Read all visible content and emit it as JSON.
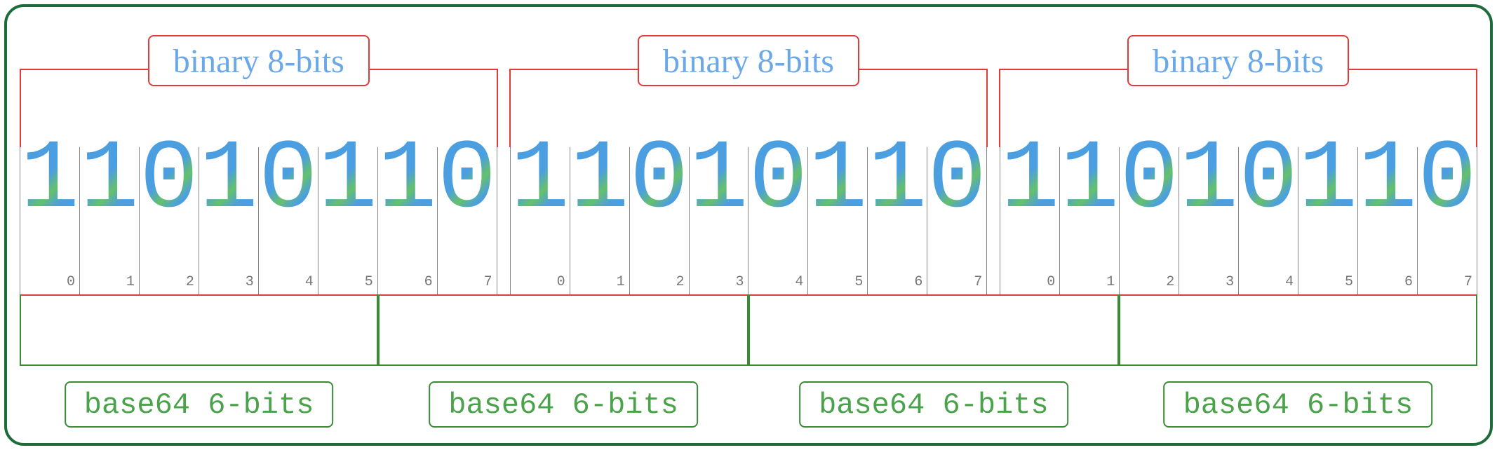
{
  "binary_label": "binary 8-bits",
  "base64_label": "base64 6-bits",
  "bytes": [
    {
      "bits": [
        "1",
        "1",
        "0",
        "1",
        "0",
        "1",
        "1",
        "0"
      ],
      "idx": [
        "0",
        "1",
        "2",
        "3",
        "4",
        "5",
        "6",
        "7"
      ]
    },
    {
      "bits": [
        "1",
        "1",
        "0",
        "1",
        "0",
        "1",
        "1",
        "0"
      ],
      "idx": [
        "0",
        "1",
        "2",
        "3",
        "4",
        "5",
        "6",
        "7"
      ]
    },
    {
      "bits": [
        "1",
        "1",
        "0",
        "1",
        "0",
        "1",
        "1",
        "0"
      ],
      "idx": [
        "0",
        "1",
        "2",
        "3",
        "4",
        "5",
        "6",
        "7"
      ]
    }
  ],
  "top_groups": 3,
  "bottom_groups": 4,
  "colors": {
    "frame": "#1d6b3a",
    "binary_border": "#e03a3a",
    "binary_text": "#6aa8e8",
    "base64_border": "#3a8a3a",
    "base64_text": "#4aa24a"
  }
}
